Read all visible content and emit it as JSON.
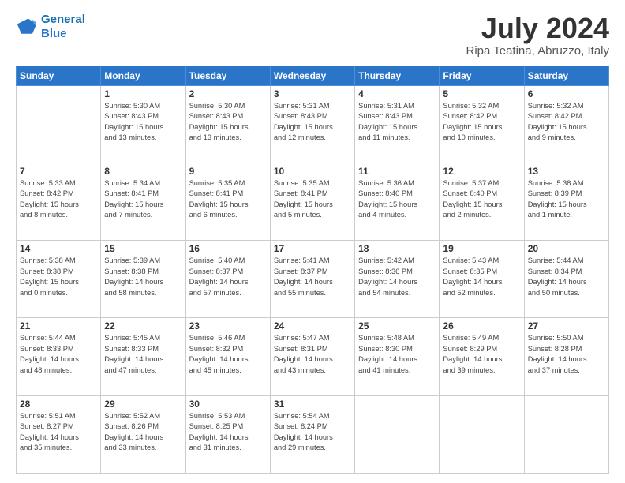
{
  "logo": {
    "line1": "General",
    "line2": "Blue"
  },
  "header": {
    "month_year": "July 2024",
    "location": "Ripa Teatina, Abruzzo, Italy"
  },
  "days": [
    "Sunday",
    "Monday",
    "Tuesday",
    "Wednesday",
    "Thursday",
    "Friday",
    "Saturday"
  ],
  "weeks": [
    [
      {
        "day": "",
        "info": ""
      },
      {
        "day": "1",
        "info": "Sunrise: 5:30 AM\nSunset: 8:43 PM\nDaylight: 15 hours\nand 13 minutes."
      },
      {
        "day": "2",
        "info": "Sunrise: 5:30 AM\nSunset: 8:43 PM\nDaylight: 15 hours\nand 13 minutes."
      },
      {
        "day": "3",
        "info": "Sunrise: 5:31 AM\nSunset: 8:43 PM\nDaylight: 15 hours\nand 12 minutes."
      },
      {
        "day": "4",
        "info": "Sunrise: 5:31 AM\nSunset: 8:43 PM\nDaylight: 15 hours\nand 11 minutes."
      },
      {
        "day": "5",
        "info": "Sunrise: 5:32 AM\nSunset: 8:42 PM\nDaylight: 15 hours\nand 10 minutes."
      },
      {
        "day": "6",
        "info": "Sunrise: 5:32 AM\nSunset: 8:42 PM\nDaylight: 15 hours\nand 9 minutes."
      }
    ],
    [
      {
        "day": "7",
        "info": "Sunrise: 5:33 AM\nSunset: 8:42 PM\nDaylight: 15 hours\nand 8 minutes."
      },
      {
        "day": "8",
        "info": "Sunrise: 5:34 AM\nSunset: 8:41 PM\nDaylight: 15 hours\nand 7 minutes."
      },
      {
        "day": "9",
        "info": "Sunrise: 5:35 AM\nSunset: 8:41 PM\nDaylight: 15 hours\nand 6 minutes."
      },
      {
        "day": "10",
        "info": "Sunrise: 5:35 AM\nSunset: 8:41 PM\nDaylight: 15 hours\nand 5 minutes."
      },
      {
        "day": "11",
        "info": "Sunrise: 5:36 AM\nSunset: 8:40 PM\nDaylight: 15 hours\nand 4 minutes."
      },
      {
        "day": "12",
        "info": "Sunrise: 5:37 AM\nSunset: 8:40 PM\nDaylight: 15 hours\nand 2 minutes."
      },
      {
        "day": "13",
        "info": "Sunrise: 5:38 AM\nSunset: 8:39 PM\nDaylight: 15 hours\nand 1 minute."
      }
    ],
    [
      {
        "day": "14",
        "info": "Sunrise: 5:38 AM\nSunset: 8:38 PM\nDaylight: 15 hours\nand 0 minutes."
      },
      {
        "day": "15",
        "info": "Sunrise: 5:39 AM\nSunset: 8:38 PM\nDaylight: 14 hours\nand 58 minutes."
      },
      {
        "day": "16",
        "info": "Sunrise: 5:40 AM\nSunset: 8:37 PM\nDaylight: 14 hours\nand 57 minutes."
      },
      {
        "day": "17",
        "info": "Sunrise: 5:41 AM\nSunset: 8:37 PM\nDaylight: 14 hours\nand 55 minutes."
      },
      {
        "day": "18",
        "info": "Sunrise: 5:42 AM\nSunset: 8:36 PM\nDaylight: 14 hours\nand 54 minutes."
      },
      {
        "day": "19",
        "info": "Sunrise: 5:43 AM\nSunset: 8:35 PM\nDaylight: 14 hours\nand 52 minutes."
      },
      {
        "day": "20",
        "info": "Sunrise: 5:44 AM\nSunset: 8:34 PM\nDaylight: 14 hours\nand 50 minutes."
      }
    ],
    [
      {
        "day": "21",
        "info": "Sunrise: 5:44 AM\nSunset: 8:33 PM\nDaylight: 14 hours\nand 48 minutes."
      },
      {
        "day": "22",
        "info": "Sunrise: 5:45 AM\nSunset: 8:33 PM\nDaylight: 14 hours\nand 47 minutes."
      },
      {
        "day": "23",
        "info": "Sunrise: 5:46 AM\nSunset: 8:32 PM\nDaylight: 14 hours\nand 45 minutes."
      },
      {
        "day": "24",
        "info": "Sunrise: 5:47 AM\nSunset: 8:31 PM\nDaylight: 14 hours\nand 43 minutes."
      },
      {
        "day": "25",
        "info": "Sunrise: 5:48 AM\nSunset: 8:30 PM\nDaylight: 14 hours\nand 41 minutes."
      },
      {
        "day": "26",
        "info": "Sunrise: 5:49 AM\nSunset: 8:29 PM\nDaylight: 14 hours\nand 39 minutes."
      },
      {
        "day": "27",
        "info": "Sunrise: 5:50 AM\nSunset: 8:28 PM\nDaylight: 14 hours\nand 37 minutes."
      }
    ],
    [
      {
        "day": "28",
        "info": "Sunrise: 5:51 AM\nSunset: 8:27 PM\nDaylight: 14 hours\nand 35 minutes."
      },
      {
        "day": "29",
        "info": "Sunrise: 5:52 AM\nSunset: 8:26 PM\nDaylight: 14 hours\nand 33 minutes."
      },
      {
        "day": "30",
        "info": "Sunrise: 5:53 AM\nSunset: 8:25 PM\nDaylight: 14 hours\nand 31 minutes."
      },
      {
        "day": "31",
        "info": "Sunrise: 5:54 AM\nSunset: 8:24 PM\nDaylight: 14 hours\nand 29 minutes."
      },
      {
        "day": "",
        "info": ""
      },
      {
        "day": "",
        "info": ""
      },
      {
        "day": "",
        "info": ""
      }
    ]
  ]
}
